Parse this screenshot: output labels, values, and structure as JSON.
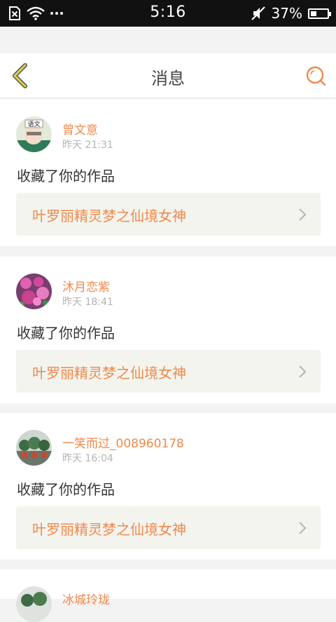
{
  "status_bar": {
    "time": "5:16",
    "battery": "37%",
    "battery_level": 0.37
  },
  "header": {
    "title": "消息"
  },
  "messages": [
    {
      "user": "曾文意",
      "time": "昨天 21:31",
      "action": "收藏了你的作品",
      "work_title": "叶罗丽精灵梦之仙境女神"
    },
    {
      "user": "沐月恋紫",
      "time": "昨天 18:41",
      "action": "收藏了你的作品",
      "work_title": "叶罗丽精灵梦之仙境女神"
    },
    {
      "user": "一笑而过_008960178",
      "time": "昨天 16:04",
      "action": "收藏了你的作品",
      "work_title": "叶罗丽精灵梦之仙境女神"
    },
    {
      "user": "冰城玲珑",
      "time": "",
      "action": "",
      "work_title": ""
    }
  ],
  "avatar_text": {
    "tag": "语文"
  },
  "colors": {
    "accent": "#f0894a",
    "back_arrow": "#d8c44a",
    "work_bg": "#f4f4ef",
    "page_bg": "#f3f3f3"
  },
  "icons": {
    "back": "back-arrow-icon",
    "search": "search-icon",
    "chevron": "chevron-right-icon"
  }
}
